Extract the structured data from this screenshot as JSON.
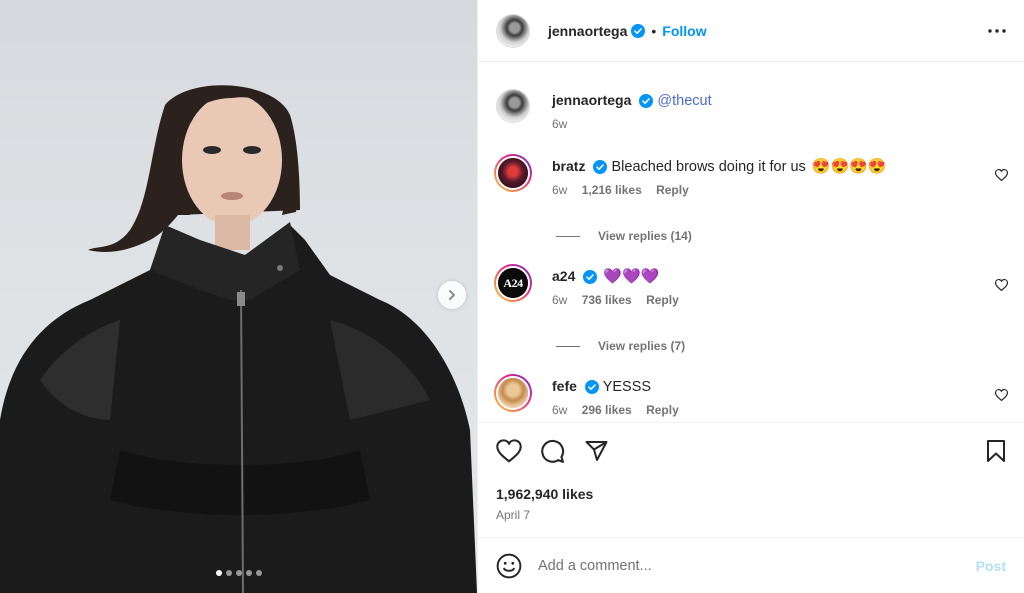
{
  "post": {
    "author": "jennaortega",
    "follow_label": "Follow",
    "bullet": "•",
    "likes": "1,962,940 likes",
    "date": "April 7",
    "carousel": {
      "count": 5,
      "active_index": 0
    }
  },
  "caption": {
    "username": "jennaortega",
    "mention": "@thecut",
    "time": "6w"
  },
  "comments": [
    {
      "username": "bratz",
      "text": "Bleached brows doing it for us",
      "emoji": "😍😍😍😍",
      "time": "6w",
      "likes": "1,216 likes",
      "reply": "Reply",
      "view_replies": "View replies (14)"
    },
    {
      "username": "a24",
      "text": "",
      "emoji": "💜💜💜",
      "time": "6w",
      "likes": "736 likes",
      "reply": "Reply",
      "view_replies": "View replies (7)",
      "avatar_text": "A24"
    },
    {
      "username": "fefe",
      "text": "YESSS",
      "emoji": "",
      "time": "6w",
      "likes": "296 likes",
      "reply": "Reply"
    }
  ],
  "add_comment": {
    "placeholder": "Add a comment...",
    "post_label": "Post"
  },
  "colors": {
    "accent": "#0095f6",
    "verified": "#0095f6",
    "post_disabled": "#b2dffc",
    "text": "#262626",
    "muted": "#737373"
  },
  "icons": [
    "verified-icon",
    "more-icon",
    "heart-icon",
    "comment-icon",
    "share-icon",
    "bookmark-icon",
    "emoji-icon",
    "chevron-right-icon"
  ]
}
